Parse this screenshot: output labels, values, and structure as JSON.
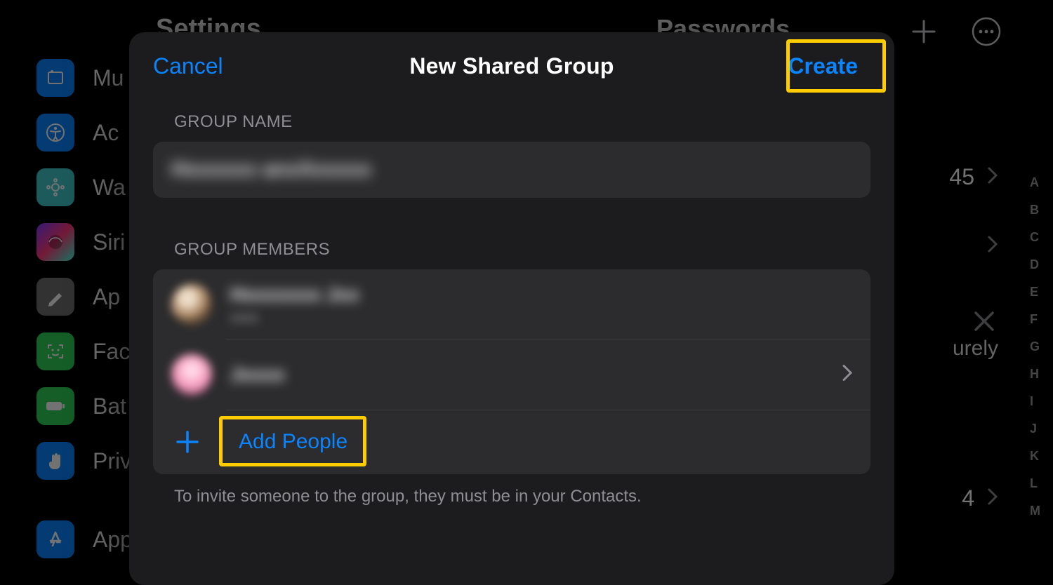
{
  "background": {
    "settings_title": "Settings",
    "passwords_title": "Passwords",
    "sidebar_items": [
      {
        "label": "Mu"
      },
      {
        "label": "Ac"
      },
      {
        "label": "Wa"
      },
      {
        "label": "Siri"
      },
      {
        "label": "Ap"
      },
      {
        "label": "Fac"
      },
      {
        "label": "Bat"
      },
      {
        "label": "Priv"
      },
      {
        "label": "App"
      }
    ],
    "right_rows": {
      "count_45": "45",
      "secure_text": "urely",
      "count_4": "4"
    },
    "alpha_index": [
      "A",
      "B",
      "C",
      "D",
      "E",
      "F",
      "G",
      "H",
      "I",
      "J",
      "K",
      "L",
      "M"
    ]
  },
  "modal": {
    "title": "New Shared Group",
    "cancel_label": "Cancel",
    "create_label": "Create",
    "group_name_section": "GROUP NAME",
    "group_name_value": "Hxxxxxx anxXxxxxx",
    "group_members_section": "GROUP MEMBERS",
    "members": [
      {
        "name": "Hxxxxxxx Jxx",
        "subtitle": "xxxx"
      },
      {
        "name": "Jxxxx",
        "subtitle": ""
      }
    ],
    "add_people_label": "Add People",
    "footer_note": "To invite someone to the group, they must be in your Contacts."
  }
}
